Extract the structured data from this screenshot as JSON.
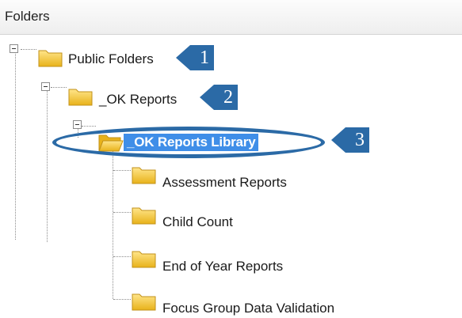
{
  "panel": {
    "title": "Folders"
  },
  "tree": {
    "public_folders": "Public Folders",
    "ok_reports": "_OK Reports",
    "ok_reports_library": "_OK Reports Library",
    "children": [
      "Assessment Reports",
      "Child Count",
      "End of Year Reports",
      "Focus Group Data Validation"
    ]
  },
  "annotations": {
    "marker1": "1",
    "marker2": "2",
    "marker3": "3"
  },
  "colors": {
    "selection": "#3f8ee8",
    "annotation": "#2b6aa6",
    "folder": "#f2c230"
  },
  "icons": {
    "collapse": "minus-box-icon",
    "folder": "folder-icon",
    "folder_open": "folder-open-icon"
  }
}
